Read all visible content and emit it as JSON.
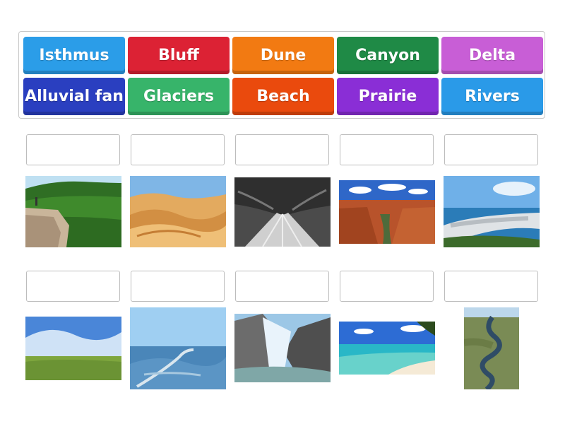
{
  "word_bank": [
    {
      "label": "Isthmus",
      "color": "#2b9de8"
    },
    {
      "label": "Bluff",
      "color": "#dc2234"
    },
    {
      "label": "Dune",
      "color": "#f27a12"
    },
    {
      "label": "Canyon",
      "color": "#1f8a46"
    },
    {
      "label": "Delta",
      "color": "#c85ed6"
    },
    {
      "label": "Alluvial fan",
      "color": "#2a3fc0"
    },
    {
      "label": "Glaciers",
      "color": "#37b46a"
    },
    {
      "label": "Beach",
      "color": "#ea4a0d"
    },
    {
      "label": "Prairie",
      "color": "#8a2ed6"
    },
    {
      "label": "Rivers",
      "color": "#2a9ae8"
    }
  ],
  "drop_targets": [
    {
      "value": ""
    },
    {
      "value": ""
    },
    {
      "value": ""
    },
    {
      "value": ""
    },
    {
      "value": ""
    },
    {
      "value": ""
    },
    {
      "value": ""
    },
    {
      "value": ""
    },
    {
      "value": ""
    },
    {
      "value": ""
    }
  ],
  "images": [
    {
      "subject": "forested-bluff"
    },
    {
      "subject": "sand-dunes"
    },
    {
      "subject": "alluvial-fan-grayscale"
    },
    {
      "subject": "canyon-with-river"
    },
    {
      "subject": "coastal-isthmus-city"
    },
    {
      "subject": "grassland-prairie"
    },
    {
      "subject": "aerial-delta"
    },
    {
      "subject": "glacier-valley"
    },
    {
      "subject": "tropical-beach"
    },
    {
      "subject": "winding-river"
    }
  ]
}
